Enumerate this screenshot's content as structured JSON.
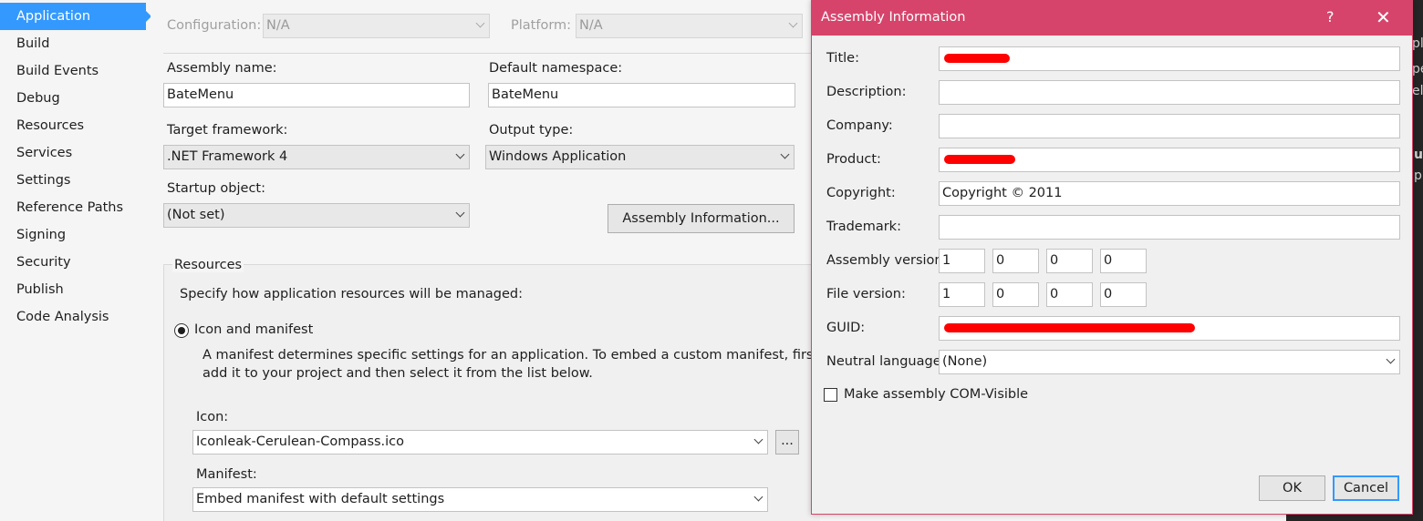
{
  "sidebar": {
    "items": [
      {
        "label": "Application",
        "active": true
      },
      {
        "label": "Build"
      },
      {
        "label": "Build Events"
      },
      {
        "label": "Debug"
      },
      {
        "label": "Resources"
      },
      {
        "label": "Services"
      },
      {
        "label": "Settings"
      },
      {
        "label": "Reference Paths"
      },
      {
        "label": "Signing"
      },
      {
        "label": "Security"
      },
      {
        "label": "Publish"
      },
      {
        "label": "Code Analysis"
      }
    ]
  },
  "main": {
    "configuration_label": "Configuration:",
    "configuration_value": "N/A",
    "platform_label": "Platform:",
    "platform_value": "N/A",
    "assembly_name_label": "Assembly name:",
    "assembly_name_value": "BateMenu",
    "default_namespace_label": "Default namespace:",
    "default_namespace_value": "BateMenu",
    "target_framework_label": "Target framework:",
    "target_framework_value": ".NET Framework 4",
    "output_type_label": "Output type:",
    "output_type_value": "Windows Application",
    "startup_object_label": "Startup object:",
    "startup_object_value": "(Not set)",
    "assembly_info_button": "Assembly Information...",
    "resources_group_label": "Resources",
    "resources_desc": "Specify how application resources will be managed:",
    "icon_manifest_option": "Icon and manifest",
    "manifest_desc_line1": "A manifest determines specific settings for an application. To embed a custom manifest, first",
    "manifest_desc_line2": "add it to your project and then select it from the list below.",
    "icon_label": "Icon:",
    "icon_value": "Iconleak-Cerulean-Compass.ico",
    "browse_button": "...",
    "manifest_label": "Manifest:",
    "manifest_value": "Embed manifest with default settings"
  },
  "dialog": {
    "title": "Assembly Information",
    "help_glyph": "?",
    "close_glyph": "✕",
    "title_label": "Title:",
    "description_label": "Description:",
    "company_label": "Company:",
    "product_label": "Product:",
    "copyright_label": "Copyright:",
    "copyright_value": "Copyright ©  2011",
    "trademark_label": "Trademark:",
    "assembly_version_label": "Assembly version:",
    "assembly_version": [
      "1",
      "0",
      "0",
      "0"
    ],
    "file_version_label": "File version:",
    "file_version": [
      "1",
      "0",
      "0",
      "0"
    ],
    "guid_label": "GUID:",
    "neutral_language_label": "Neutral language:",
    "neutral_language_value": "(None)",
    "com_visible_label": "Make assembly COM-Visible",
    "ok_button": "OK",
    "cancel_button": "Cancel"
  },
  "colors": {
    "accent": "#3399ff",
    "dialog_title_bar": "#d6446b",
    "redaction": "#ff0000"
  },
  "background_panel": {
    "fragments": [
      "pl",
      "pe",
      "el",
      "u",
      "p"
    ]
  }
}
